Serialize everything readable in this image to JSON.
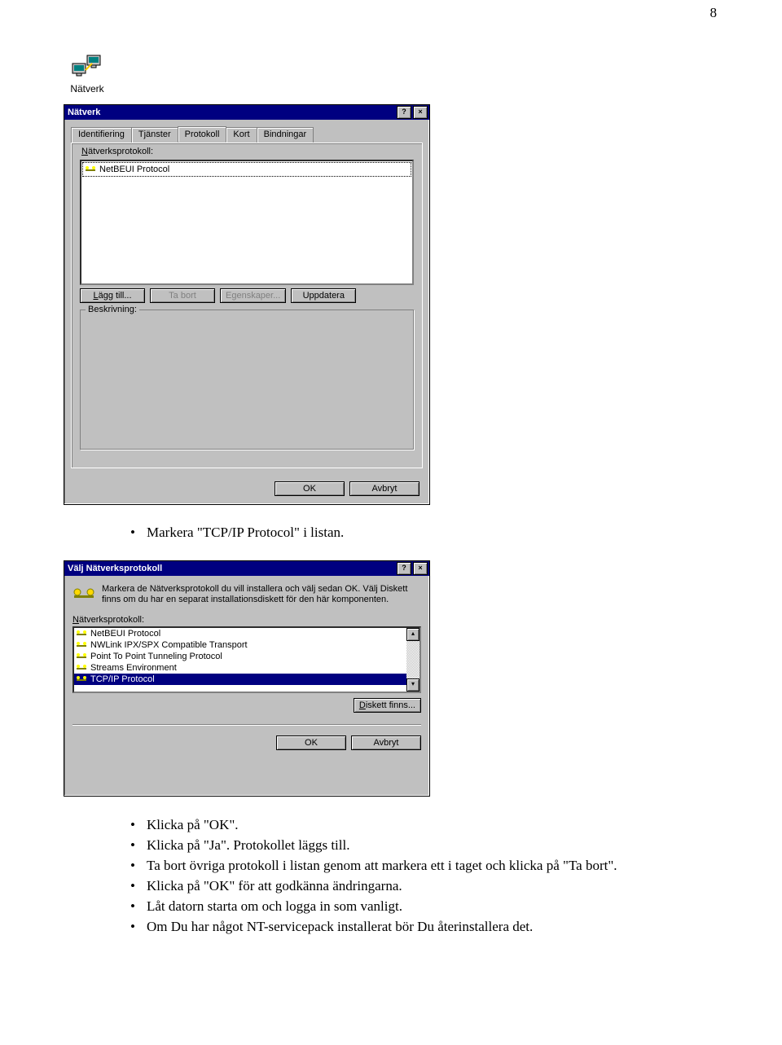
{
  "page_number": "8",
  "desktop_icon_label": "Nätverk",
  "dialog1": {
    "title": "Nätverk",
    "help_btn": "?",
    "close_btn": "×",
    "tabs": [
      "Identifiering",
      "Tjänster",
      "Protokoll",
      "Kort",
      "Bindningar"
    ],
    "active_tab_index": 2,
    "group1_label_pre": "N",
    "group1_label_rest": "ätverksprotokoll:",
    "list_items": [
      "NetBEUI Protocol"
    ],
    "buttons": {
      "add": "Lägg till...",
      "remove": "Ta bort",
      "properties": "Egenskaper...",
      "update": "Uppdatera"
    },
    "group2_label": "Beskrivning:",
    "ok": "OK",
    "cancel": "Avbryt"
  },
  "bullet_mid": "Markera \"TCP/IP Protocol\" i listan.",
  "dialog2": {
    "title": "Välj Nätverksprotokoll",
    "help_btn": "?",
    "close_btn": "×",
    "instructions": "Markera de Nätverksprotokoll  du vill installera och välj sedan OK. Välj Diskett finns om du har en separat installationsdiskett för den här komponenten.",
    "list_label_pre": "N",
    "list_label_rest": "ätverksprotokoll:",
    "protocols": [
      "NetBEUI Protocol",
      "NWLink IPX/SPX Compatible Transport",
      "Point To Point Tunneling Protocol",
      "Streams Environment",
      "TCP/IP Protocol"
    ],
    "selected_index": 4,
    "disk_btn": "Diskett finns...",
    "ok": "OK",
    "cancel": "Avbryt"
  },
  "bullets_bottom": [
    "Klicka på \"OK\".",
    "Klicka på \"Ja\". Protokollet läggs till.",
    "Ta bort övriga protokoll i listan genom att markera ett i taget och klicka på \"Ta bort\".",
    "Klicka på \"OK\" för att godkänna ändringarna.",
    "Låt datorn starta om och logga in som vanligt.",
    "Om Du har något NT-servicepack installerat bör Du återinstallera det."
  ]
}
